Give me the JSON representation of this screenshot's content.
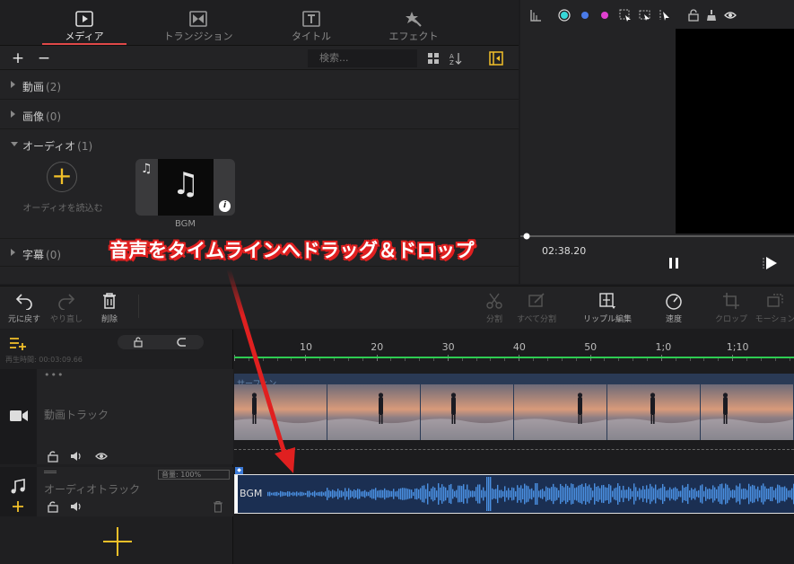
{
  "tabs": [
    {
      "label": "メディア",
      "icon": "media-icon",
      "active": true
    },
    {
      "label": "トランジション",
      "icon": "transition-icon",
      "active": false
    },
    {
      "label": "タイトル",
      "icon": "title-icon",
      "active": false
    },
    {
      "label": "エフェクト",
      "icon": "effect-icon",
      "active": false
    }
  ],
  "media_toolbar": {
    "add": "+",
    "remove": "−",
    "search_placeholder": "検索..."
  },
  "categories": [
    {
      "label": "動画",
      "count": "(2)",
      "expanded": false
    },
    {
      "label": "画像",
      "count": "(0)",
      "expanded": false
    },
    {
      "label": "オーディオ",
      "count": "(1)",
      "expanded": true
    },
    {
      "label": "字幕",
      "count": "(0)",
      "expanded": false
    }
  ],
  "import_audio_label": "オーディオを読込む",
  "bgm_label": "BGM",
  "preview": {
    "time": "02:38.20"
  },
  "edit_toolbar": [
    {
      "label": "元に戻す",
      "icon": "undo-icon",
      "enabled": true
    },
    {
      "label": "やり直し",
      "icon": "redo-icon",
      "enabled": false
    },
    {
      "label": "削除",
      "icon": "trash-icon",
      "enabled": true
    },
    {
      "label": "分割",
      "icon": "scissors-icon",
      "enabled": false
    },
    {
      "label": "すべて分割",
      "icon": "split-all-icon",
      "enabled": false
    },
    {
      "label": "リップル編集",
      "icon": "ripple-edit-icon",
      "enabled": true
    },
    {
      "label": "速度",
      "icon": "speed-icon",
      "enabled": true
    },
    {
      "label": "クロップ",
      "icon": "crop-icon",
      "enabled": false
    },
    {
      "label": "モーション",
      "icon": "motion-icon",
      "enabled": false
    }
  ],
  "timeline": {
    "duration_label": "再生時間: 00:03:09.66",
    "ruler_labels": [
      "10",
      "20",
      "30",
      "40",
      "50",
      "1;0",
      "1;10"
    ],
    "video_track_label": "動画トラック",
    "video_clip_title": "サーフィン",
    "audio_track_label": "オーディオトラック",
    "volume_label": "音量: 100%",
    "audio_clip_label": "BGM"
  },
  "annotation": "音声をタイムラインへドラッグ＆ドロップ",
  "colors": {
    "accent_yellow": "#f2c029",
    "active_tab_underline": "#e04848",
    "playhead_green": "#2ecc52",
    "annotation_red": "#e02020",
    "waveform_blue": "#4a90e2"
  }
}
